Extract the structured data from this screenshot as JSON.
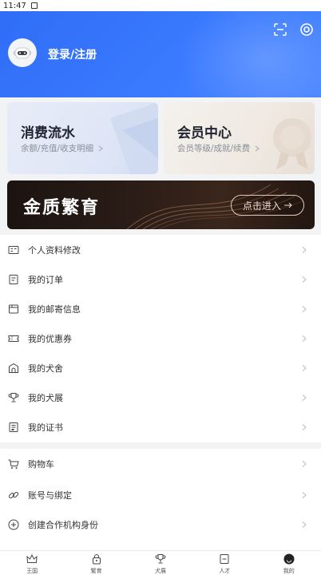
{
  "status_bar": {
    "time": "11:47"
  },
  "header": {
    "login_label": "登录/注册"
  },
  "cards": {
    "consume": {
      "title": "消费流水",
      "subtitle": "余额/充值/收支明细"
    },
    "member": {
      "title": "会员中心",
      "subtitle": "会员等级/成就/续费"
    }
  },
  "banner": {
    "title": "金质繁育",
    "button_label": "点击进入"
  },
  "menu_primary": [
    {
      "label": "个人资料修改",
      "icon": "profile-card-icon"
    },
    {
      "label": "我的订单",
      "icon": "order-icon"
    },
    {
      "label": "我的邮寄信息",
      "icon": "mail-box-icon"
    },
    {
      "label": "我的优惠券",
      "icon": "coupon-icon"
    },
    {
      "label": "我的犬舍",
      "icon": "kennel-icon"
    },
    {
      "label": "我的犬展",
      "icon": "trophy-icon"
    },
    {
      "label": "我的证书",
      "icon": "certificate-icon"
    }
  ],
  "menu_secondary": [
    {
      "label": "购物车",
      "icon": "cart-icon"
    },
    {
      "label": "账号与绑定",
      "icon": "link-icon"
    },
    {
      "label": "创建合作机构身份",
      "icon": "add-circle-icon"
    }
  ],
  "tabbar": [
    {
      "label": "王国",
      "icon": "crown-icon"
    },
    {
      "label": "繁育",
      "icon": "lock-bag-icon"
    },
    {
      "label": "犬展",
      "icon": "trophy-icon"
    },
    {
      "label": "人才",
      "icon": "badge-icon"
    },
    {
      "label": "我的",
      "icon": "face-icon",
      "active": true
    }
  ],
  "colors": {
    "brand_blue": "#3474fa",
    "banner_dark": "#221612"
  }
}
